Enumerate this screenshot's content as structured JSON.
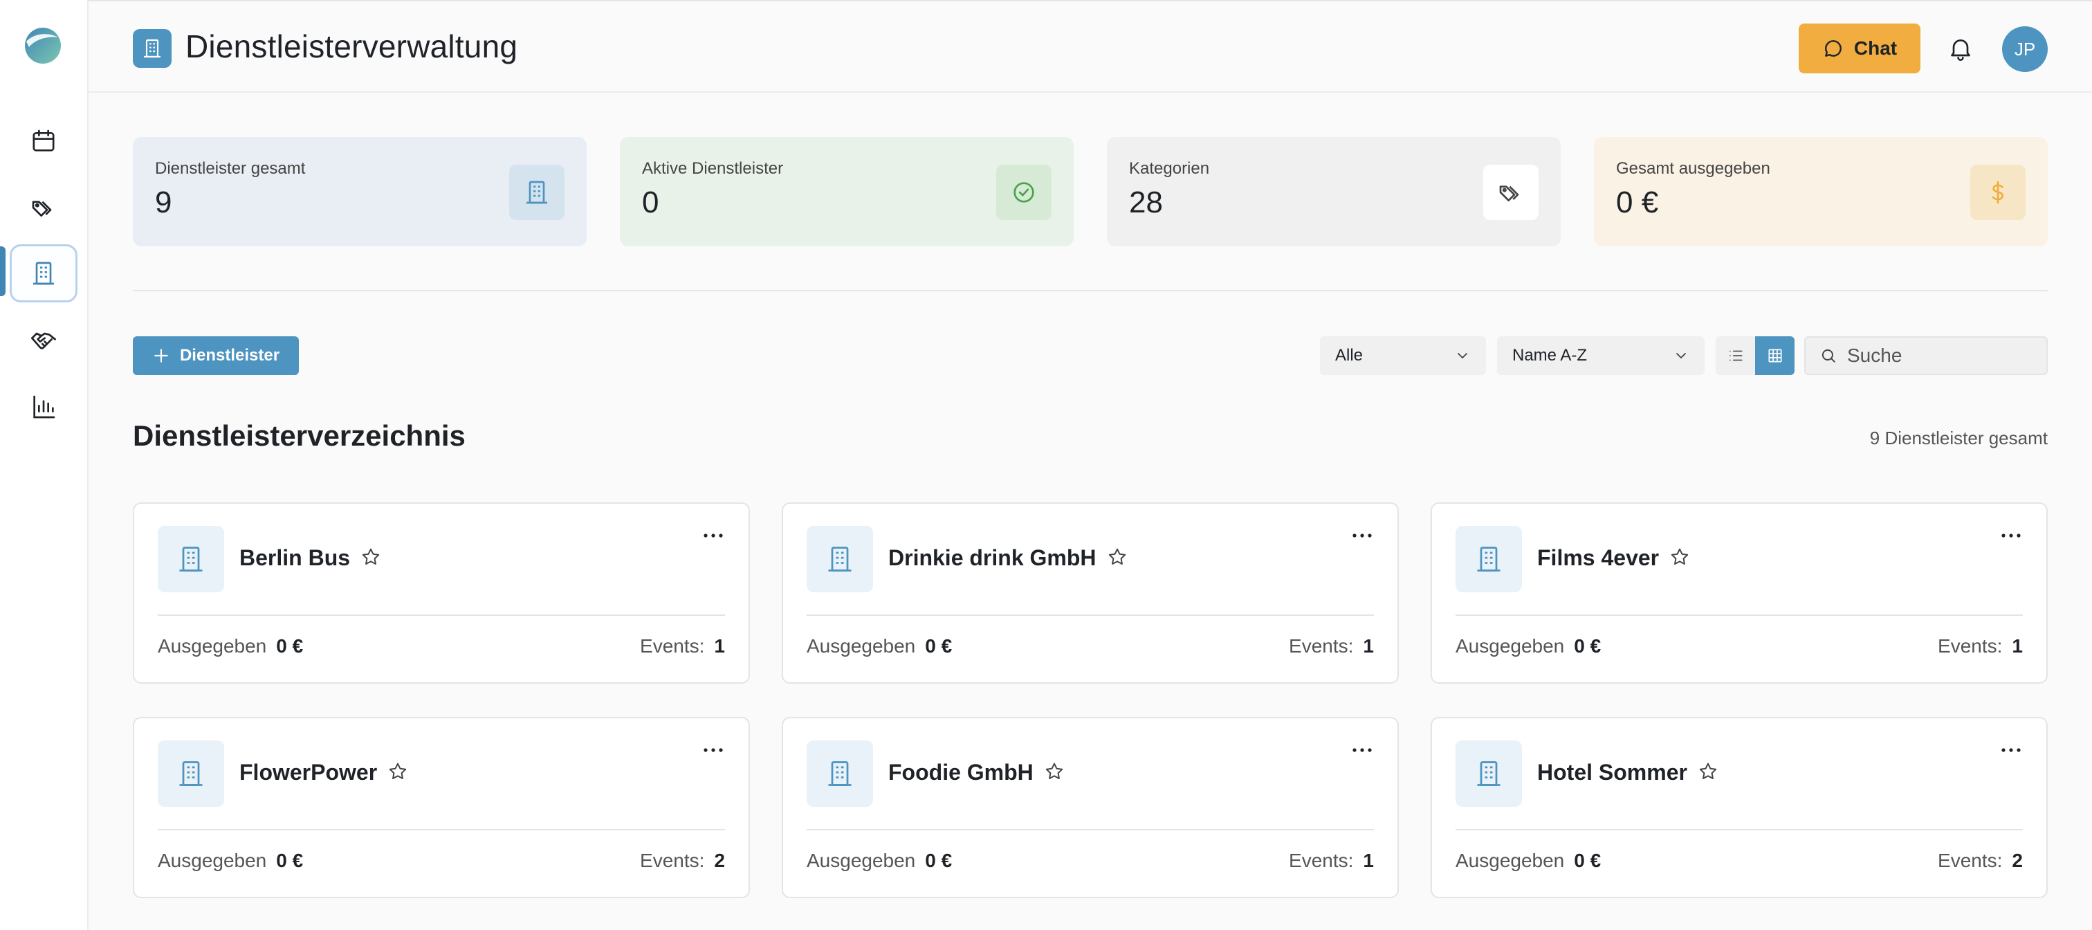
{
  "header": {
    "title": "Dienstleisterverwaltung",
    "chat_label": "Chat",
    "avatar_initials": "JP"
  },
  "sidebar": {
    "items": [
      {
        "name": "calendar-icon",
        "active": false
      },
      {
        "name": "tags-icon",
        "active": false
      },
      {
        "name": "building-icon",
        "active": true
      },
      {
        "name": "handshake-icon",
        "active": false
      },
      {
        "name": "bar-chart-icon",
        "active": false
      }
    ]
  },
  "stats": [
    {
      "label": "Dienstleister gesamt",
      "value": "9",
      "icon": "building-icon",
      "bg": "#e8eef3",
      "icon_bg": "#d5e3ee",
      "icon_color": "#4d94c0"
    },
    {
      "label": "Aktive Dienstleister",
      "value": "0",
      "icon": "check-circle-icon",
      "bg": "#e9f2e9",
      "icon_bg": "#d6ead5",
      "icon_color": "#4aa24a"
    },
    {
      "label": "Kategorien",
      "value": "28",
      "icon": "tags-icon",
      "bg": "#f0f0f0",
      "icon_bg": "#ffffff",
      "icon_color": "#444444"
    },
    {
      "label": "Gesamt ausgegeben",
      "value": "0 €",
      "icon": "dollar-icon",
      "bg": "#faf2e4",
      "icon_bg": "#f7e6c6",
      "icon_color": "#f1ad3f"
    }
  ],
  "toolbar": {
    "add_label": "Dienstleister",
    "filter_value": "Alle",
    "sort_value": "Name A-Z",
    "search_placeholder": "Suche",
    "view_mode": "grid"
  },
  "directory": {
    "title": "Dienstleisterverzeichnis",
    "count_text": "9 Dienstleister gesamt",
    "spent_label": "Ausgegeben",
    "events_label": "Events:"
  },
  "vendors": [
    {
      "name": "Berlin Bus",
      "spent": "0 €",
      "events": "1"
    },
    {
      "name": "Drinkie drink GmbH",
      "spent": "0 €",
      "events": "1"
    },
    {
      "name": "Films 4ever",
      "spent": "0 €",
      "events": "1"
    },
    {
      "name": "FlowerPower",
      "spent": "0 €",
      "events": "2"
    },
    {
      "name": "Foodie GmbH",
      "spent": "0 €",
      "events": "1"
    },
    {
      "name": "Hotel Sommer",
      "spent": "0 €",
      "events": "2"
    }
  ],
  "colors": {
    "accent": "#4d94c0",
    "chat": "#f1ad3f"
  }
}
